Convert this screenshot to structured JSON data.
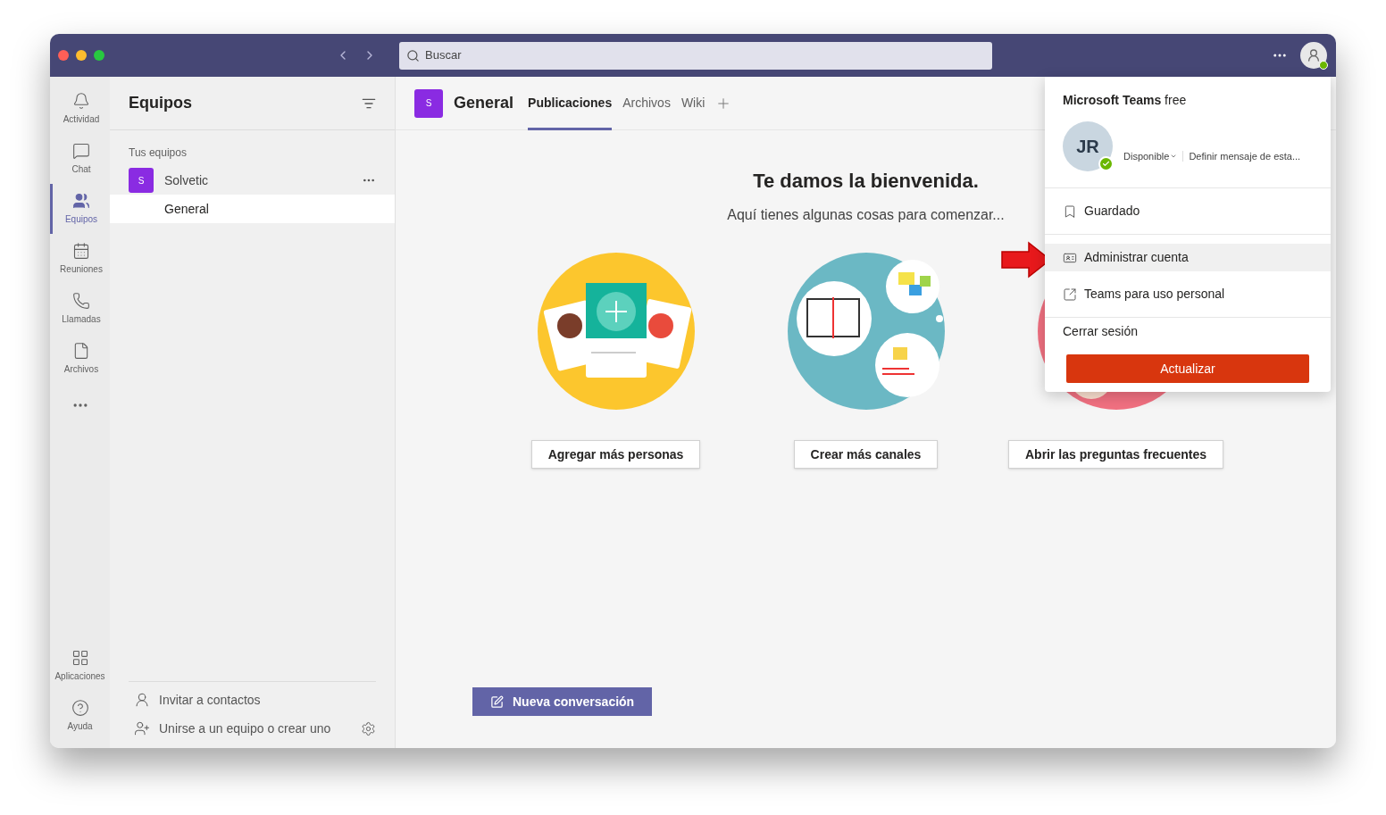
{
  "titlebar": {
    "search": {
      "placeholder": "Buscar"
    }
  },
  "rail": {
    "items": [
      {
        "label": "Actividad",
        "selected": false
      },
      {
        "label": "Chat",
        "selected": false
      },
      {
        "label": "Equipos",
        "selected": true
      },
      {
        "label": "Reuniones",
        "selected": false
      },
      {
        "label": "Llamadas",
        "selected": false
      },
      {
        "label": "Archivos",
        "selected": false
      }
    ],
    "bottom_items": [
      {
        "label": "Aplicaciones"
      },
      {
        "label": "Ayuda"
      }
    ]
  },
  "teams_panel": {
    "title": "Equipos",
    "section": "Tus equipos",
    "teams": [
      {
        "avatar": "S",
        "name": "Solvetic",
        "channels": [
          {
            "name": "General",
            "selected": true
          }
        ]
      }
    ],
    "footer": [
      "Invitar a contactos",
      "Unirse a un equipo o crear uno"
    ]
  },
  "channel_header": {
    "avatar": "S",
    "name": "General",
    "tabs": [
      {
        "label": "Publicaciones",
        "selected": true
      },
      {
        "label": "Archivos",
        "selected": false
      },
      {
        "label": "Wiki",
        "selected": false
      }
    ]
  },
  "welcome": {
    "title": "Te damos la bienvenida.",
    "subtitle": "Aquí tienes algunas cosas para comenzar...",
    "cards": [
      {
        "kind": "people",
        "button": "Agregar más personas"
      },
      {
        "kind": "channels",
        "button": "Crear más canales"
      },
      {
        "kind": "faq",
        "button": "Abrir las preguntas frecuentes"
      }
    ]
  },
  "compose_button": "Nueva conversación",
  "profile_menu": {
    "product": "**Microsoft Teams** free",
    "initials": "JR",
    "status": "Disponible",
    "status_message": "Definir mensaje de esta...",
    "items": [
      {
        "kind": "saved",
        "label": "Guardado",
        "selected": false
      },
      {
        "kind": "account",
        "label": "Administrar cuenta",
        "selected": true
      },
      {
        "kind": "personal",
        "label": "Teams para uso personal",
        "selected": false
      },
      {
        "kind": "signout",
        "label": "Cerrar sesión",
        "selected": false
      }
    ],
    "upgrade_button": "Actualizar"
  }
}
